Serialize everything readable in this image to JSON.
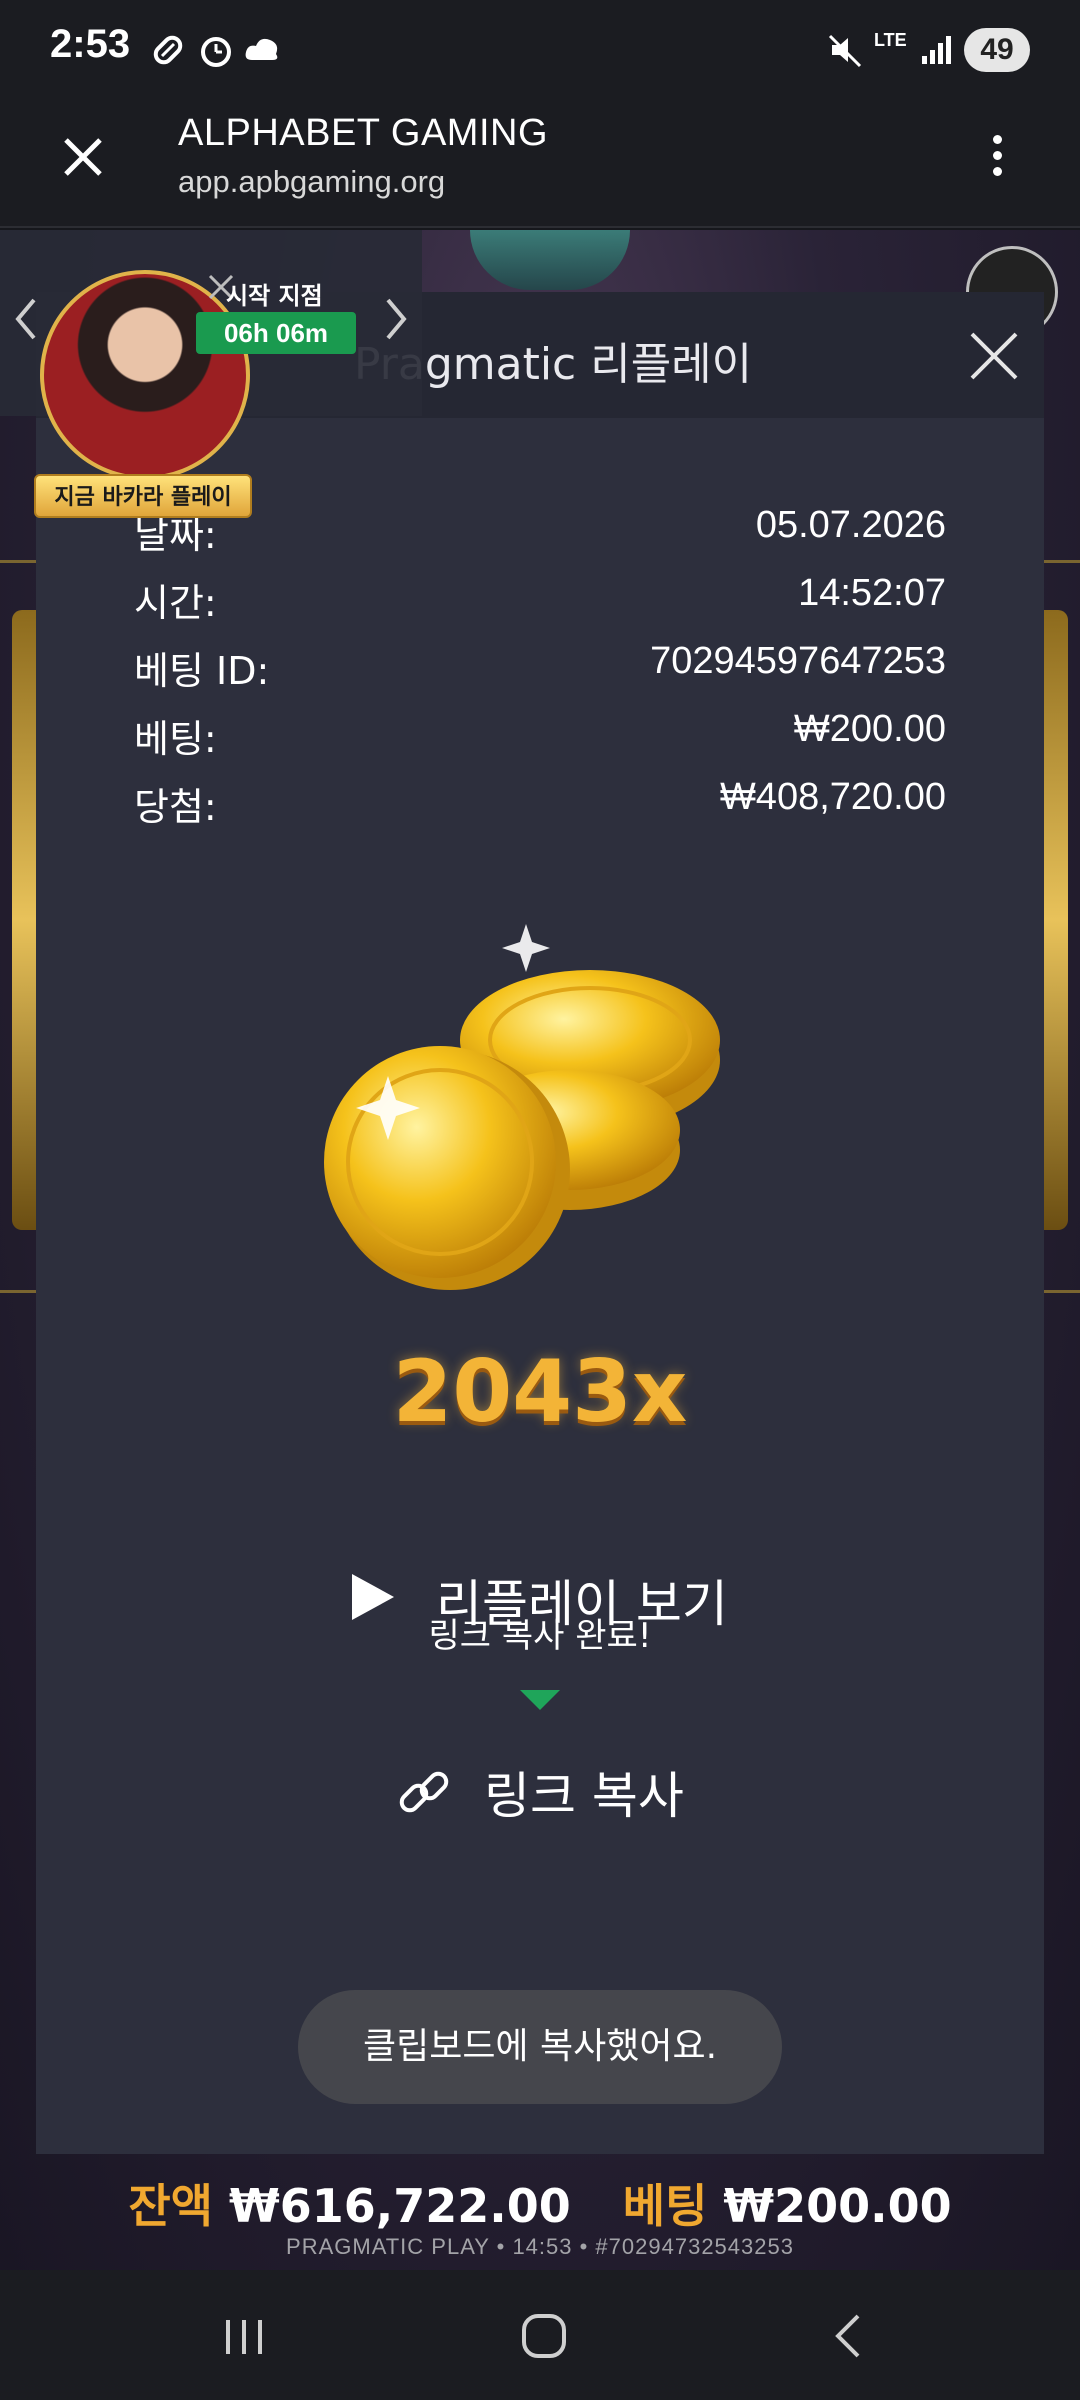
{
  "status_bar": {
    "time": "2:53",
    "battery": "49",
    "network": "LTE"
  },
  "browser": {
    "title": "ALPHABET GAMING",
    "url": "app.apbgaming.org"
  },
  "modal": {
    "title": "Pragmatic 리플레이",
    "rows": [
      {
        "label": "날짜:",
        "value": "05.07.2026"
      },
      {
        "label": "시간:",
        "value": "14:52:07"
      },
      {
        "label": "베팅 ID:",
        "value": "70294597647253"
      },
      {
        "label": "베팅:",
        "value": "₩200.00"
      },
      {
        "label": "당첨:",
        "value": "₩408,720.00"
      }
    ],
    "multiplier": "2043x",
    "replay_label": "리플레이 보기",
    "copied_label": "링크 복사 완료!",
    "copy_link_label": "링크 복사"
  },
  "toast": "클립보드에 복사했어요.",
  "promo": {
    "start_label": "시작 지점",
    "timer": "06h 06m",
    "badge": "지금 바카라 플레이"
  },
  "game_footer": {
    "balance_label": "잔액",
    "balance_value": "₩616,722.00",
    "bet_label": "베팅",
    "bet_value": "₩200.00",
    "info": "PRAGMATIC PLAY • 14:53 • #70294732543253"
  },
  "colors": {
    "accent_gold": "#f0a830",
    "modal_bg": "#2d2f3d",
    "timer_green": "#1a9a4f"
  }
}
